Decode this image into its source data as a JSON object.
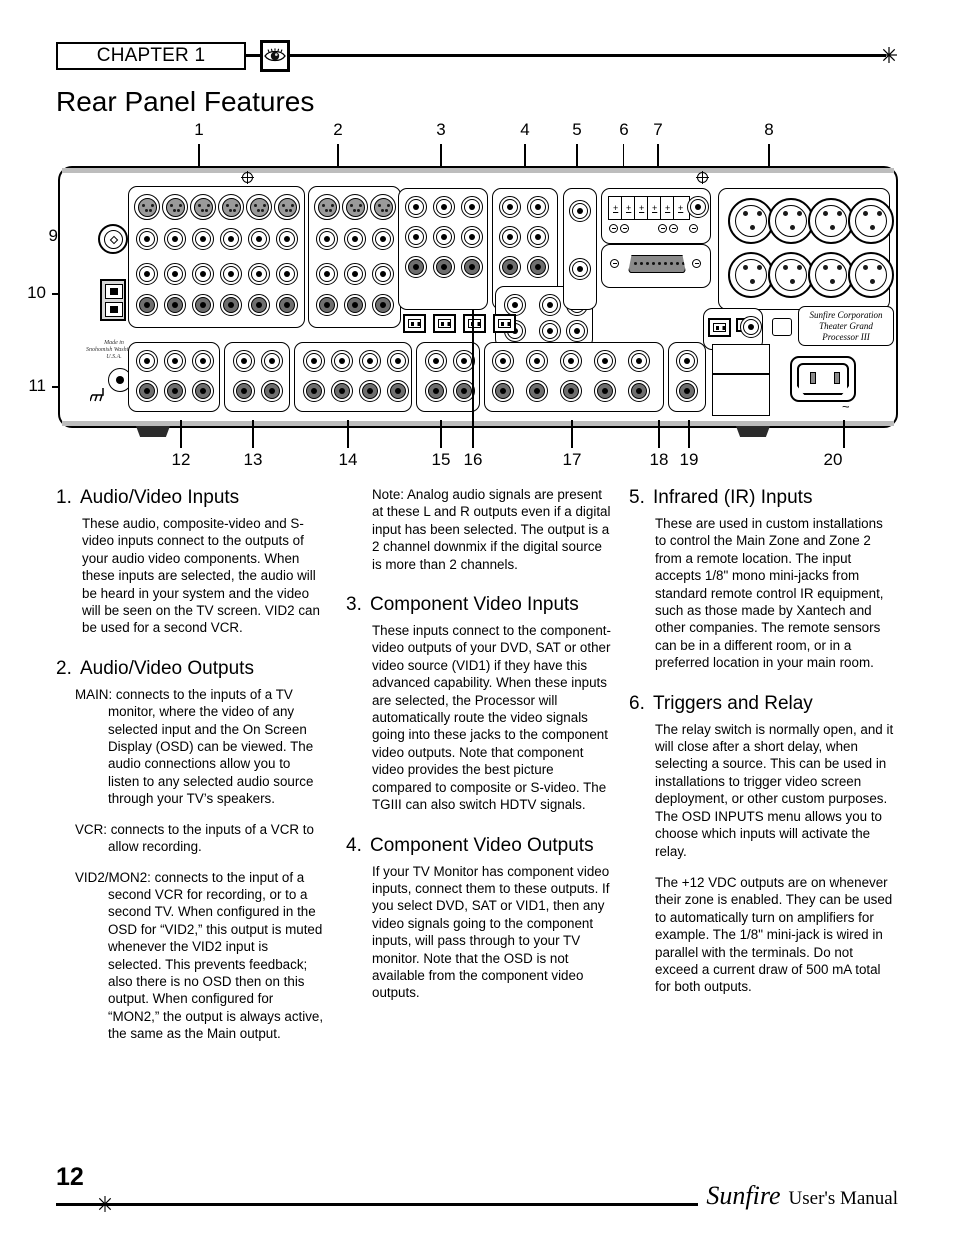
{
  "header": {
    "chapter_label": "CHAPTER 1",
    "eye_icon": "eye-icon",
    "star_icon": "star-icon"
  },
  "page_title": "Rear Panel Features",
  "diagram": {
    "top_callouts": [
      "1",
      "2",
      "3",
      "4",
      "5",
      "6",
      "7",
      "8"
    ],
    "left_callouts": [
      "9",
      "10",
      "11"
    ],
    "bottom_callouts": [
      "12",
      "13",
      "14",
      "15",
      "16",
      "17",
      "18",
      "19",
      "20"
    ],
    "made_in": "Made in\nSnohomish Washington\nU.S.A.",
    "made_in_line1": "Made in",
    "made_in_line2": "Snohomish Washington",
    "made_in_line3": "U.S.A.",
    "brand_plate_line1": "Sunfire Corporation",
    "brand_plate_line2": "Theater Grand",
    "brand_plate_line3": "Processor III",
    "ac_symbol": "~",
    "terminal_marks": [
      "+",
      "+",
      "+",
      "+",
      "+",
      "+"
    ]
  },
  "sections": {
    "s1": {
      "num": "1.",
      "title": "Audio/Video Inputs",
      "body": "These audio, composite-video and S-video inputs connect to the outputs of your audio video components. When these inputs are selected, the audio will be heard in your system and the video will be seen on the TV screen. VID2 can be used for a second VCR."
    },
    "s2": {
      "num": "2.",
      "title": "Audio/Video Outputs",
      "main": "MAIN: connects to the inputs of a TV monitor, where the video of any selected input and the On Screen Display (OSD) can be viewed. The audio connections allow you to listen to any selected audio source through your TV’s speakers.",
      "vcr": "VCR: connects to the inputs of a VCR to allow recording.",
      "vid2": "VID2/MON2: connects to the input of a second VCR for recording, or to a second TV. When configured in the OSD for “VID2,” this output is muted whenever the VID2 input is selected. This prevents feedback; also there is no OSD then on this output. When configured for “MON2,” the output is always active, the same as the Main output."
    },
    "note": "Note: Analog audio signals are present at these L and R outputs even if a digital input has been selected. The output is a 2 channel downmix if the digital source is more than 2 channels.",
    "s3": {
      "num": "3.",
      "title": "Component Video Inputs",
      "body": "These inputs connect to the component-video outputs of your DVD, SAT or other video source (VID1) if they have this advanced capability. When these inputs are selected, the Processor will automatically route the video signals going into these jacks to the component video outputs. Note that component video provides the best picture compared to composite or S-video. The TGIII can also switch HDTV signals."
    },
    "s4": {
      "num": "4.",
      "title": "Component Video Outputs",
      "body": "If your TV Monitor has component video inputs, connect them to these outputs. If you select DVD, SAT or VID1, then any video signals going to the component inputs, will pass through to your TV monitor. Note that the OSD is not available from the component video outputs."
    },
    "s5": {
      "num": "5.",
      "title": "Infrared (IR) Inputs",
      "body": "These are used in custom installations to control the Main Zone and Zone 2 from a remote location. The input accepts 1/8\" mono mini-jacks from standard remote control IR equipment, such as those made by Xantech and other companies. The remote sensors can be in a different room, or in a preferred location in your main room."
    },
    "s6": {
      "num": "6.",
      "title": "Triggers and Relay",
      "body1": "The relay switch is normally open, and it will close after a short delay, when selecting a source. This can be used in installations to trigger video screen deployment, or other custom purposes. The OSD INPUTS menu allows you to choose which inputs will activate the relay.",
      "body2": "The +12 VDC outputs are on whenever their zone is enabled. They can be used to automatically turn on amplifiers for example. The 1/8\" mini-jack is wired in parallel with the terminals. Do not exceed a current draw of 500 mA total for both outputs."
    }
  },
  "footer": {
    "page_number": "12",
    "brand": "Sunfire",
    "brand_sub": "User's Manual",
    "star_icon": "star-icon"
  }
}
